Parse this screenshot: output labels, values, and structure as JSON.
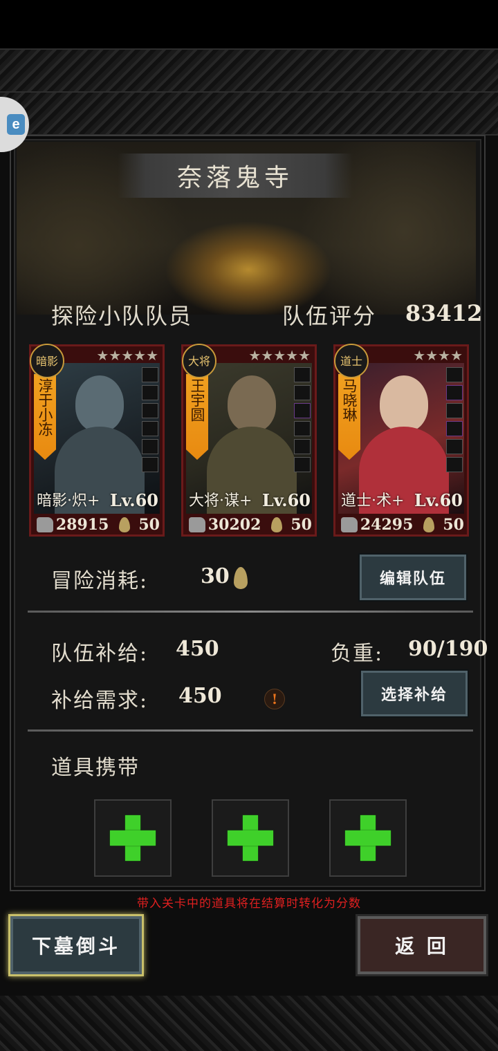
{
  "side_badge": {
    "label": "e"
  },
  "dungeon": {
    "title": "奈落鬼寺"
  },
  "team": {
    "members_label": "探险小队队员",
    "score_label": "队伍评分",
    "score_value": "83412"
  },
  "cards": [
    {
      "badge": "暗影",
      "name": "淳于小冻",
      "class": "暗影·炽+",
      "level": "Lv.60",
      "power": "28915",
      "cost": "50",
      "stars": "★★★★★"
    },
    {
      "badge": "大将",
      "name": "王宇圆",
      "class": "大将·谋+",
      "level": "Lv.60",
      "power": "30202",
      "cost": "50",
      "stars": "★★★★★"
    },
    {
      "badge": "道士",
      "name": "马晓琳",
      "class": "道士·术+",
      "level": "Lv.60",
      "power": "24295",
      "cost": "50",
      "stars": "★★★★"
    }
  ],
  "adventure": {
    "cost_label": "冒险消耗:",
    "cost_value": "30"
  },
  "buttons": {
    "edit_team": "编辑队伍",
    "select_supply": "选择补给",
    "enter": "下墓倒斗",
    "back": "返 回"
  },
  "supply": {
    "team_label": "队伍补给:",
    "team_value": "450",
    "weight_label": "负重:",
    "weight_value": "90/190",
    "need_label": "补给需求:",
    "need_value": "450",
    "warn_mark": "!"
  },
  "items": {
    "label": "道具携带"
  },
  "hint": "带入关卡中的道具将在结算时转化为分数",
  "colors": {
    "hint": "#e02020",
    "plus": "#3fd02a",
    "name_strip": "#f0a020"
  }
}
